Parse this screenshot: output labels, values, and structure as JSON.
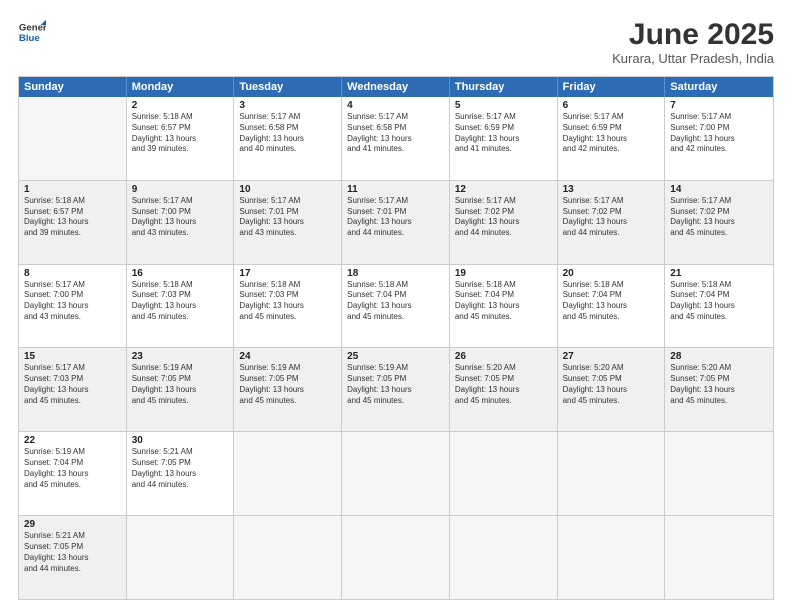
{
  "header": {
    "logo_line1": "General",
    "logo_line2": "Blue",
    "month": "June 2025",
    "location": "Kurara, Uttar Pradesh, India"
  },
  "weekdays": [
    "Sunday",
    "Monday",
    "Tuesday",
    "Wednesday",
    "Thursday",
    "Friday",
    "Saturday"
  ],
  "rows": [
    [
      {
        "day": "",
        "lines": [],
        "empty": true
      },
      {
        "day": "2",
        "lines": [
          "Sunrise: 5:18 AM",
          "Sunset: 6:57 PM",
          "Daylight: 13 hours",
          "and 39 minutes."
        ]
      },
      {
        "day": "3",
        "lines": [
          "Sunrise: 5:17 AM",
          "Sunset: 6:58 PM",
          "Daylight: 13 hours",
          "and 40 minutes."
        ]
      },
      {
        "day": "4",
        "lines": [
          "Sunrise: 5:17 AM",
          "Sunset: 6:58 PM",
          "Daylight: 13 hours",
          "and 41 minutes."
        ]
      },
      {
        "day": "5",
        "lines": [
          "Sunrise: 5:17 AM",
          "Sunset: 6:59 PM",
          "Daylight: 13 hours",
          "and 41 minutes."
        ]
      },
      {
        "day": "6",
        "lines": [
          "Sunrise: 5:17 AM",
          "Sunset: 6:59 PM",
          "Daylight: 13 hours",
          "and 42 minutes."
        ]
      },
      {
        "day": "7",
        "lines": [
          "Sunrise: 5:17 AM",
          "Sunset: 7:00 PM",
          "Daylight: 13 hours",
          "and 42 minutes."
        ]
      }
    ],
    [
      {
        "day": "1",
        "lines": [
          "Sunrise: 5:18 AM",
          "Sunset: 6:57 PM",
          "Daylight: 13 hours",
          "and 39 minutes."
        ]
      },
      {
        "day": "9",
        "lines": [
          "Sunrise: 5:17 AM",
          "Sunset: 7:00 PM",
          "Daylight: 13 hours",
          "and 43 minutes."
        ]
      },
      {
        "day": "10",
        "lines": [
          "Sunrise: 5:17 AM",
          "Sunset: 7:01 PM",
          "Daylight: 13 hours",
          "and 43 minutes."
        ]
      },
      {
        "day": "11",
        "lines": [
          "Sunrise: 5:17 AM",
          "Sunset: 7:01 PM",
          "Daylight: 13 hours",
          "and 44 minutes."
        ]
      },
      {
        "day": "12",
        "lines": [
          "Sunrise: 5:17 AM",
          "Sunset: 7:02 PM",
          "Daylight: 13 hours",
          "and 44 minutes."
        ]
      },
      {
        "day": "13",
        "lines": [
          "Sunrise: 5:17 AM",
          "Sunset: 7:02 PM",
          "Daylight: 13 hours",
          "and 44 minutes."
        ]
      },
      {
        "day": "14",
        "lines": [
          "Sunrise: 5:17 AM",
          "Sunset: 7:02 PM",
          "Daylight: 13 hours",
          "and 45 minutes."
        ]
      }
    ],
    [
      {
        "day": "8",
        "lines": [
          "Sunrise: 5:17 AM",
          "Sunset: 7:00 PM",
          "Daylight: 13 hours",
          "and 43 minutes."
        ]
      },
      {
        "day": "16",
        "lines": [
          "Sunrise: 5:18 AM",
          "Sunset: 7:03 PM",
          "Daylight: 13 hours",
          "and 45 minutes."
        ]
      },
      {
        "day": "17",
        "lines": [
          "Sunrise: 5:18 AM",
          "Sunset: 7:03 PM",
          "Daylight: 13 hours",
          "and 45 minutes."
        ]
      },
      {
        "day": "18",
        "lines": [
          "Sunrise: 5:18 AM",
          "Sunset: 7:04 PM",
          "Daylight: 13 hours",
          "and 45 minutes."
        ]
      },
      {
        "day": "19",
        "lines": [
          "Sunrise: 5:18 AM",
          "Sunset: 7:04 PM",
          "Daylight: 13 hours",
          "and 45 minutes."
        ]
      },
      {
        "day": "20",
        "lines": [
          "Sunrise: 5:18 AM",
          "Sunset: 7:04 PM",
          "Daylight: 13 hours",
          "and 45 minutes."
        ]
      },
      {
        "day": "21",
        "lines": [
          "Sunrise: 5:18 AM",
          "Sunset: 7:04 PM",
          "Daylight: 13 hours",
          "and 45 minutes."
        ]
      }
    ],
    [
      {
        "day": "15",
        "lines": [
          "Sunrise: 5:17 AM",
          "Sunset: 7:03 PM",
          "Daylight: 13 hours",
          "and 45 minutes."
        ]
      },
      {
        "day": "23",
        "lines": [
          "Sunrise: 5:19 AM",
          "Sunset: 7:05 PM",
          "Daylight: 13 hours",
          "and 45 minutes."
        ]
      },
      {
        "day": "24",
        "lines": [
          "Sunrise: 5:19 AM",
          "Sunset: 7:05 PM",
          "Daylight: 13 hours",
          "and 45 minutes."
        ]
      },
      {
        "day": "25",
        "lines": [
          "Sunrise: 5:19 AM",
          "Sunset: 7:05 PM",
          "Daylight: 13 hours",
          "and 45 minutes."
        ]
      },
      {
        "day": "26",
        "lines": [
          "Sunrise: 5:20 AM",
          "Sunset: 7:05 PM",
          "Daylight: 13 hours",
          "and 45 minutes."
        ]
      },
      {
        "day": "27",
        "lines": [
          "Sunrise: 5:20 AM",
          "Sunset: 7:05 PM",
          "Daylight: 13 hours",
          "and 45 minutes."
        ]
      },
      {
        "day": "28",
        "lines": [
          "Sunrise: 5:20 AM",
          "Sunset: 7:05 PM",
          "Daylight: 13 hours",
          "and 45 minutes."
        ]
      }
    ],
    [
      {
        "day": "22",
        "lines": [
          "Sunrise: 5:19 AM",
          "Sunset: 7:04 PM",
          "Daylight: 13 hours",
          "and 45 minutes."
        ]
      },
      {
        "day": "30",
        "lines": [
          "Sunrise: 5:21 AM",
          "Sunset: 7:05 PM",
          "Daylight: 13 hours",
          "and 44 minutes."
        ]
      },
      {
        "day": "",
        "lines": [],
        "empty": true
      },
      {
        "day": "",
        "lines": [],
        "empty": true
      },
      {
        "day": "",
        "lines": [],
        "empty": true
      },
      {
        "day": "",
        "lines": [],
        "empty": true
      },
      {
        "day": "",
        "lines": [],
        "empty": true
      }
    ],
    [
      {
        "day": "29",
        "lines": [
          "Sunrise: 5:21 AM",
          "Sunset: 7:05 PM",
          "Daylight: 13 hours",
          "and 44 minutes."
        ]
      },
      {
        "day": "",
        "lines": [],
        "empty": true
      },
      {
        "day": "",
        "lines": [],
        "empty": true
      },
      {
        "day": "",
        "lines": [],
        "empty": true
      },
      {
        "day": "",
        "lines": [],
        "empty": true
      },
      {
        "day": "",
        "lines": [],
        "empty": true
      },
      {
        "day": "",
        "lines": [],
        "empty": true
      }
    ]
  ]
}
